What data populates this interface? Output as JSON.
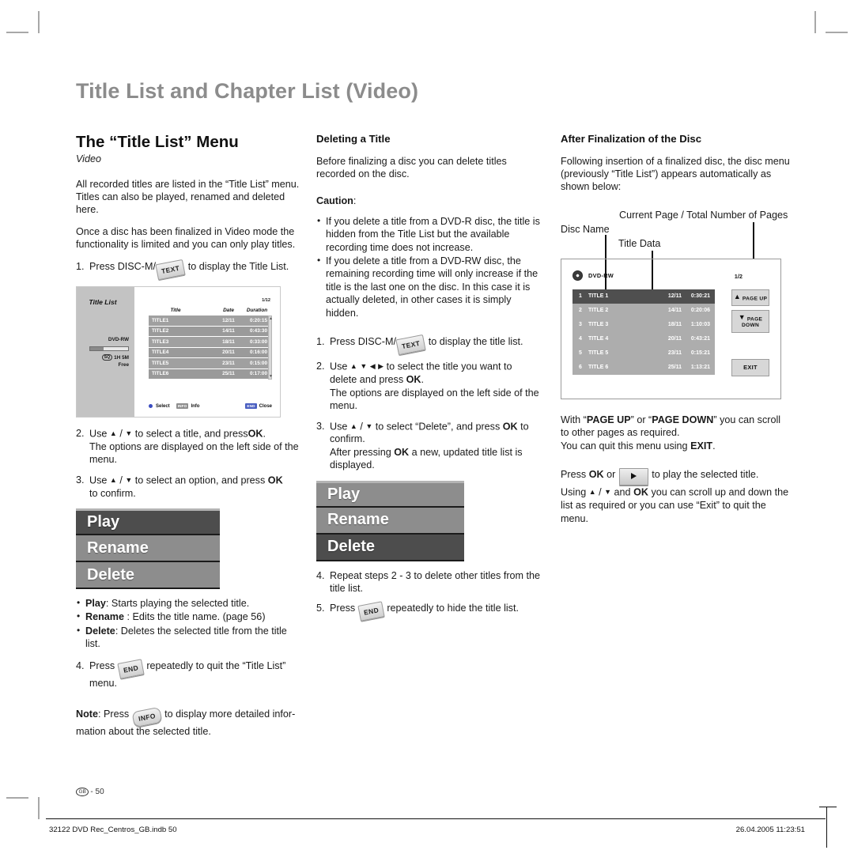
{
  "doc": {
    "running_head": "Title List and Chapter List (Video)"
  },
  "left_column": {
    "heading": "The “Title List” Menu",
    "subheading_italic": "Video",
    "intro": "All recorded titles are listed in the “Title List” menu. Titles can also be played, renamed and deleted here.",
    "intro2": "Once a disc has been finalized in Video mode the functionality is limited and you can only play titles.",
    "step1_marker": "1.",
    "step1_pre": "Press DISC-M/",
    "step1_key": "TEXT",
    "step1_post": "to display the Title List.",
    "step2_marker": "2.",
    "step2_a": "Use",
    "step2_b": "/",
    "step2_c": "to select a title, and press",
    "step2_ok": "OK",
    "step2_d": ".",
    "step2_line2": "The options are displayed on the left side of the menu.",
    "step3_marker": "3.",
    "step3_a": "Use",
    "step3_b": "/",
    "step3_c": "to select an option, and press",
    "step3_ok": "OK",
    "step3_line2": "to confirm.",
    "options": [
      {
        "label": "Play",
        "selected": true
      },
      {
        "label": "Rename",
        "selected": false
      },
      {
        "label": "Delete",
        "selected": false
      }
    ],
    "option_descriptions": [
      {
        "name": "Play",
        "sep": ":",
        "text": " Starts playing the selected title."
      },
      {
        "name": "Rename",
        "sep": " :",
        "text": " Edits the title name. (page 56)"
      },
      {
        "name": "Delete",
        "sep": ":",
        "text": " Deletes the selected title from the title list."
      }
    ],
    "step4_marker": "4.",
    "step4_pre": "Press",
    "step4_key": "END",
    "step4_post": "repeatedly to quit the “Title List” menu.",
    "note_label": "Note",
    "note_pre": ": Press",
    "note_key": "INFO",
    "note_post": "to display more detailed infor-mation about the selected title.",
    "note_post_line1": "to display more detailed infor-",
    "note_post_line2": "mation about the selected title."
  },
  "title_list_screen": {
    "menu_name": "Title List",
    "disc_type": "DVD-RW",
    "free_quality": "SQ",
    "free_time": "1H 5M",
    "free_label": "Free",
    "page_indicator": "1/12",
    "columns": [
      "Title",
      "Date",
      "Duration"
    ],
    "rows": [
      {
        "title": "TITLE1",
        "date": "12/11",
        "duration": "0:20:15"
      },
      {
        "title": "TITLE2",
        "date": "14/11",
        "duration": "0:43:30"
      },
      {
        "title": "TITLE3",
        "date": "18/11",
        "duration": "0:33:00"
      },
      {
        "title": "TITLE4",
        "date": "20/11",
        "duration": "0:16:00"
      },
      {
        "title": "TITLE5",
        "date": "23/11",
        "duration": "0:15:00"
      },
      {
        "title": "TITLE6",
        "date": "25/11",
        "duration": "0:17:00"
      }
    ],
    "footer": {
      "select_label": "Select",
      "info_key": "INFO",
      "info_label": "Info",
      "close_key": "END",
      "close_label": "Close"
    }
  },
  "mid_column": {
    "heading": "Deleting a Title",
    "intro": "Before finalizing a disc you can delete titles recorded on the disc.",
    "caution_label": "Caution",
    "caution_colon": ":",
    "cautions": [
      "If you delete a title from a DVD-R disc, the title is hidden from the Title List but the available recording time does not increase.",
      "If you delete a title from a DVD-RW disc, the remaining recording time will only increase if the title is the last one on the disc. In this case it is actually deleted, in other cases it is simply hidden."
    ],
    "step1_marker": "1.",
    "step1_pre": "Press DISC-M/",
    "step1_key": "TEXT",
    "step1_post": "to display the title list.",
    "step2_marker": "2.",
    "step2_a": "Use",
    "step2_c": "to select the title you want to delete and press",
    "step2_ok": "OK",
    "step2_d": ".",
    "step2_line2": "The options are displayed on the left side of the menu.",
    "step3_marker": "3.",
    "step3_a": "Use",
    "step3_b": "/",
    "step3_c": "to select “Delete”, and press",
    "step3_ok": "OK",
    "step3_d": "to",
    "step3_line2": "confirm.",
    "step3_line3_a": "After pressing",
    "step3_line3_ok": "OK",
    "step3_line3_b": "a new, updated title list is displayed.",
    "options": [
      {
        "label": "Play",
        "selected": false
      },
      {
        "label": "Rename",
        "selected": false
      },
      {
        "label": "Delete",
        "selected": true
      }
    ],
    "step4_marker": "4.",
    "step4_text": "Repeat steps 2 - 3 to delete other titles from the title list.",
    "step5_marker": "5.",
    "step5_pre": "Press",
    "step5_key": "END",
    "step5_post": "repeatedly to hide the title list."
  },
  "right_column": {
    "heading": "After Finalization of the Disc",
    "intro": "Following insertion of a finalized disc, the disc menu (previously “Title List”) appears automatically as shown below:",
    "callout_page": "Current Page / Total Number of Pages",
    "callout_disc": "Disc Name",
    "callout_title": "Title Data",
    "para_scroll_a": "With “",
    "para_scroll_pageup": "PAGE UP",
    "para_scroll_b": "” or “",
    "para_scroll_pagedown": "PAGE DOWN",
    "para_scroll_c": "” you can scroll to other pages as required.",
    "para_quit_a": "You can quit this menu using ",
    "para_quit_exit": "EXIT",
    "para_quit_b": ".",
    "para_play_a": "Press ",
    "para_play_ok": "OK",
    "para_play_b": " or",
    "para_play_c": "to play the selected title.",
    "para_using_a": "Using",
    "para_using_sep": "/",
    "para_using_b": "and",
    "para_using_ok": "OK",
    "para_using_c": "you can scroll up and down the list as required or you can use “Exit” to quit the menu."
  },
  "disc_menu_screen": {
    "disc_name": "DVD-RW",
    "page_indicator": "1/2",
    "rows": [
      {
        "num": "1",
        "title": "TITLE 1",
        "date": "12/11",
        "duration": "0:30:21",
        "selected": true
      },
      {
        "num": "2",
        "title": "TITLE 2",
        "date": "14/11",
        "duration": "0:20:06",
        "selected": false
      },
      {
        "num": "3",
        "title": "TITLE 3",
        "date": "18/11",
        "duration": "1:10:03",
        "selected": false
      },
      {
        "num": "4",
        "title": "TITLE 4",
        "date": "20/11",
        "duration": "0:43:21",
        "selected": false
      },
      {
        "num": "5",
        "title": "TITLE 5",
        "date": "23/11",
        "duration": "0:15:21",
        "selected": false
      },
      {
        "num": "6",
        "title": "TITLE 6",
        "date": "25/11",
        "duration": "1:13:21",
        "selected": false
      }
    ],
    "page_up": "PAGE UP",
    "page_down": "PAGE DOWN",
    "exit": "EXIT"
  },
  "footer": {
    "locale_badge": "GB",
    "page_number": "- 50",
    "file_name": "32122 DVD Rec_Centros_GB.indb   50",
    "timestamp": "26.04.2005   11:23:51"
  }
}
